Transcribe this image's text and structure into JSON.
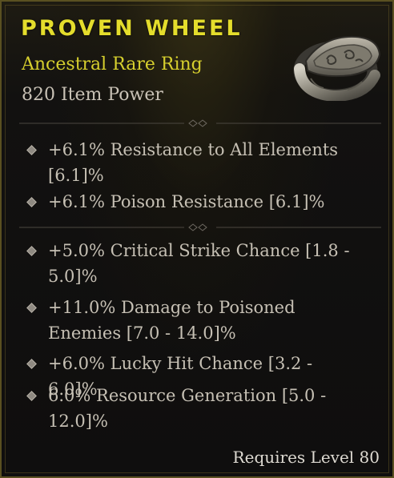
{
  "item": {
    "name": "PROVEN WHEEL",
    "type": "Ancestral Rare Ring",
    "item_power": "820 Item Power",
    "image_icon": "stone-ring-icon"
  },
  "implicit_affixes": [
    {
      "text": "+6.1% Resistance to All Elements [6.1]%"
    },
    {
      "text": "+6.1% Poison Resistance [6.1]%"
    }
  ],
  "affixes": [
    {
      "text": "+5.0% Critical Strike Chance [1.8 - 5.0]%"
    },
    {
      "text": "+11.0% Damage to Poisoned Enemies [7.0 - 14.0]%"
    },
    {
      "text": "+6.0% Lucky Hit Chance [3.2 - 6.0]%"
    },
    {
      "text": "6.0% Resource Generation [5.0 - 12.0]%"
    }
  ],
  "requirement": "Requires Level 80",
  "colors": {
    "title": "#e4dd2c",
    "subtitle": "#d6cf2e",
    "stat_text": "#c6c0b4",
    "border": "#5a5021",
    "background": "#0f0e0e"
  }
}
